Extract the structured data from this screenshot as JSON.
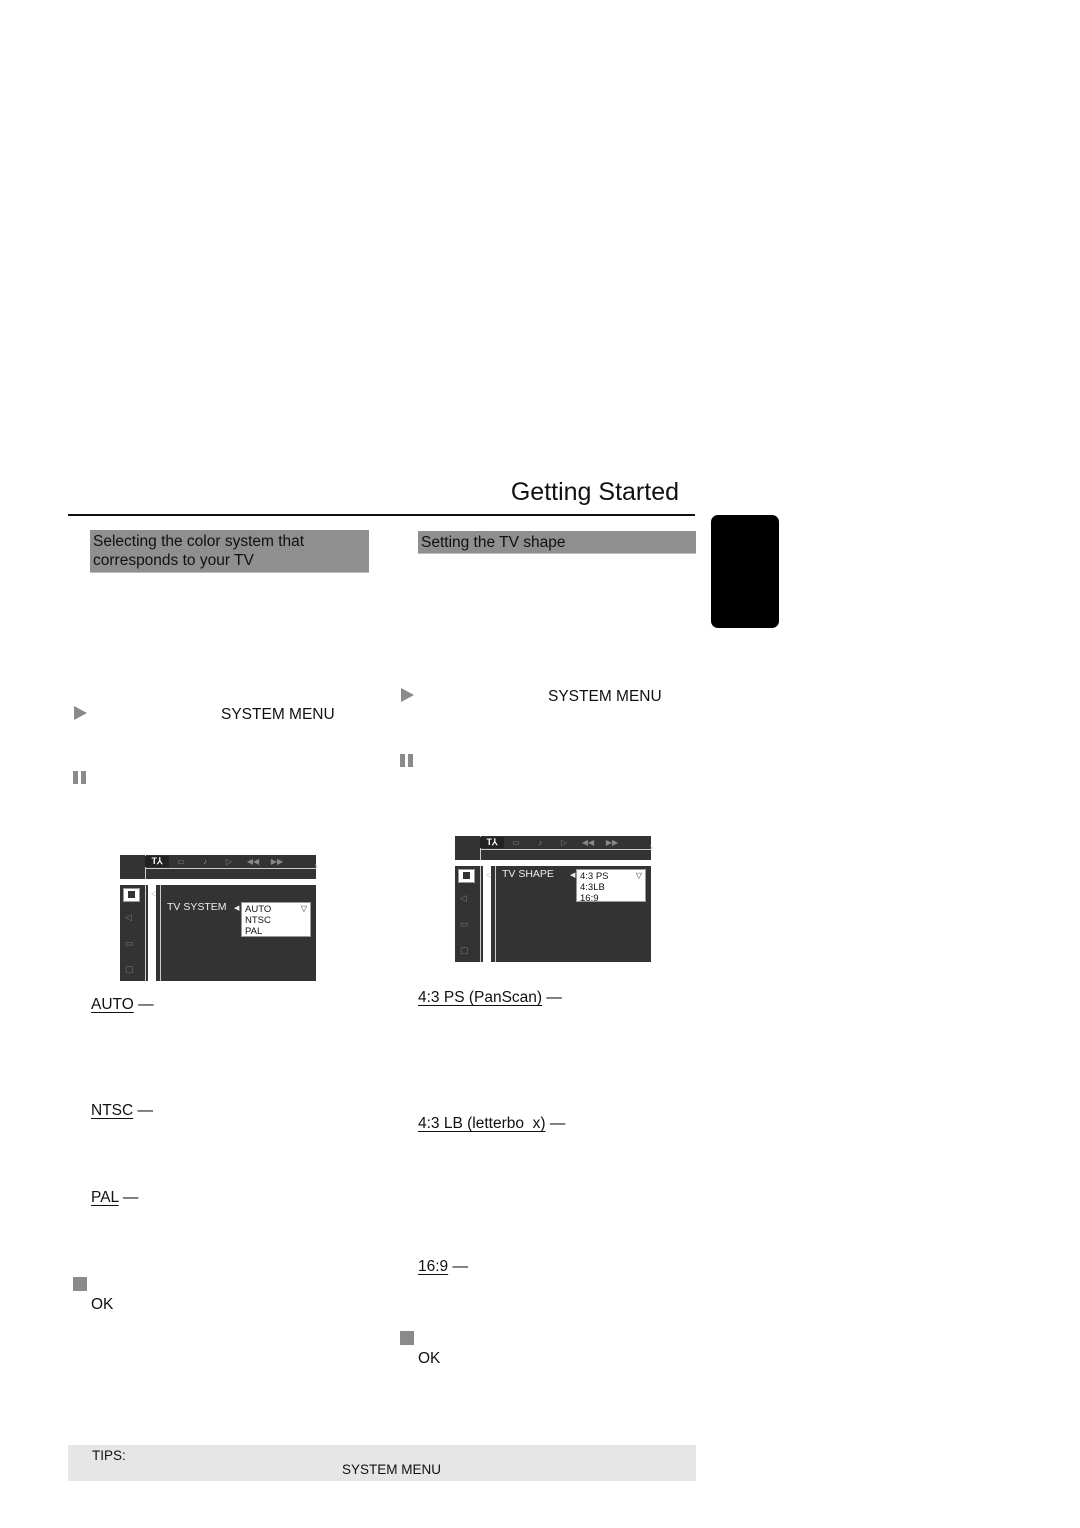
{
  "page": {
    "title": "Getting Started"
  },
  "left_section": {
    "heading": "Selecting the color system that corresponds to your TV",
    "step1_key": "SYSTEM MENU",
    "osd": {
      "tabs": [
        "setup-icon",
        "display-icon",
        "audio-icon",
        "play-icon",
        "rewind-icon",
        "fast-forward-icon"
      ],
      "setting_label": "TV SYSTEM",
      "options": [
        "AUTO",
        "NTSC",
        "PAL"
      ],
      "selected": "AUTO"
    },
    "options": [
      {
        "term": "AUTO",
        "dash": "—"
      },
      {
        "term": "NTSC",
        "dash": "—"
      },
      {
        "term": "PAL",
        "dash": "—"
      }
    ],
    "confirm_key": "OK"
  },
  "right_section": {
    "heading": "Setting the TV shape",
    "step1_key": "SYSTEM MENU",
    "osd": {
      "tabs": [
        "setup-icon",
        "display-icon",
        "audio-icon",
        "play-icon",
        "rewind-icon",
        "fast-forward-icon"
      ],
      "setting_label": "TV SHAPE",
      "options": [
        "4:3 PS",
        "4:3LB",
        "16:9"
      ],
      "selected": "4:3 PS"
    },
    "options": [
      {
        "term": "4:3 PS (PanScan)",
        "dash": "—"
      },
      {
        "term": "4:3 LB (letterbo  x)",
        "dash": "—"
      },
      {
        "term": "16:9",
        "dash": "—"
      }
    ],
    "confirm_key": "OK"
  },
  "tips": {
    "label": "TIPS:",
    "key": "SYSTEM MENU"
  },
  "colors": {
    "heading_bg": "#8f8f8f",
    "osd_bg": "#333333",
    "tips_bg": "#e6e6e6",
    "step_icon": "#8a8a8a"
  }
}
